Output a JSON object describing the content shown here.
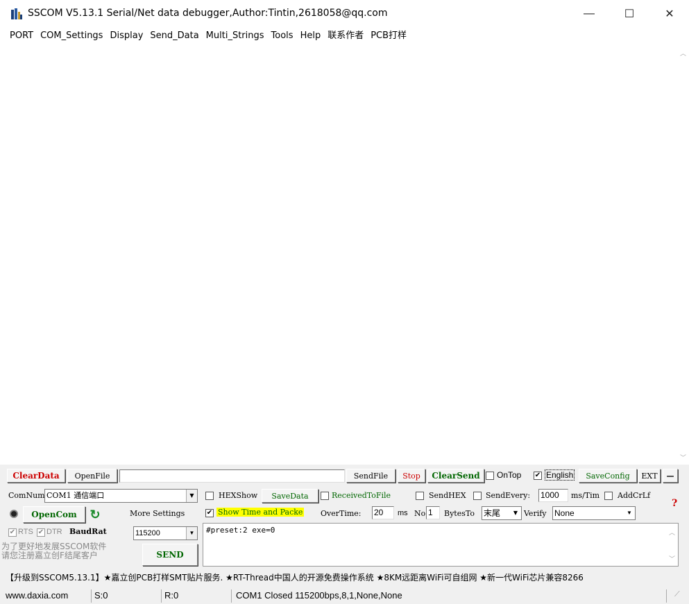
{
  "window": {
    "title": "SSCOM V5.13.1 Serial/Net data debugger,Author:Tintin,2618058@qq.com"
  },
  "window_controls": {
    "minimize": "—",
    "maximize": "☐",
    "close": "✕"
  },
  "menu": [
    "PORT",
    "COM_Settings",
    "Display",
    "Send_Data",
    "Multi_Strings",
    "Tools",
    "Help",
    "联系作者",
    "PCB打样"
  ],
  "toolbar": {
    "clear_data": "ClearData",
    "open_file": "OpenFile",
    "file_path": "",
    "send_file": "SendFile",
    "stop": "Stop",
    "clear_send": "ClearSend",
    "on_top": "OnTop",
    "english": "English",
    "save_config": "SaveConfig",
    "ext": "EXT",
    "minus": "—"
  },
  "port": {
    "comnum_label": "ComNum",
    "comnum_value": "COM1 通信端口",
    "open_com": "OpenCom",
    "more_settings": "More Settings",
    "rts": "RTS",
    "dtr": "DTR",
    "baud_label": "BaudRat",
    "baud_value": "115200",
    "promo": "为了更好地发展SSCOM软件\n请您注册嘉立创F结尾客户",
    "send": "SEND"
  },
  "options": {
    "hexshow": "HEXShow",
    "savedata": "SaveData",
    "received_to_file": "ReceivedToFile",
    "sendhex": "SendHEX",
    "send_every": "SendEvery:",
    "send_every_value": "1000",
    "ms_tim": "ms/Tim",
    "addcrlf": "AddCrLf",
    "help_mark": "?",
    "show_time": "Show Time and Packe",
    "overtime": "OverTime:",
    "overtime_value": "20",
    "ms": "ms",
    "no": "No",
    "no_value": "1",
    "bytes_to": "BytesTo",
    "bytes_to_value": "末尾",
    "verify": "Verify",
    "verify_value": "None"
  },
  "send_text": "#preset:2 exe=0",
  "ticker": "【升级到SSCOM5.13.1】★嘉立创PCB打样SMT贴片服务. ★RT-Thread中国人的开源免费操作系统 ★8KM远距离WiFi可自组网 ★新一代WiFi芯片兼容8266",
  "status": {
    "site": "www.daxia.com",
    "sent": "S:0",
    "received": "R:0",
    "port_state": "COM1 Closed  115200bps,8,1,None,None"
  },
  "colors": {
    "accent_green": "#006600",
    "accent_red": "#cc0000",
    "highlight": "#ffff00"
  }
}
